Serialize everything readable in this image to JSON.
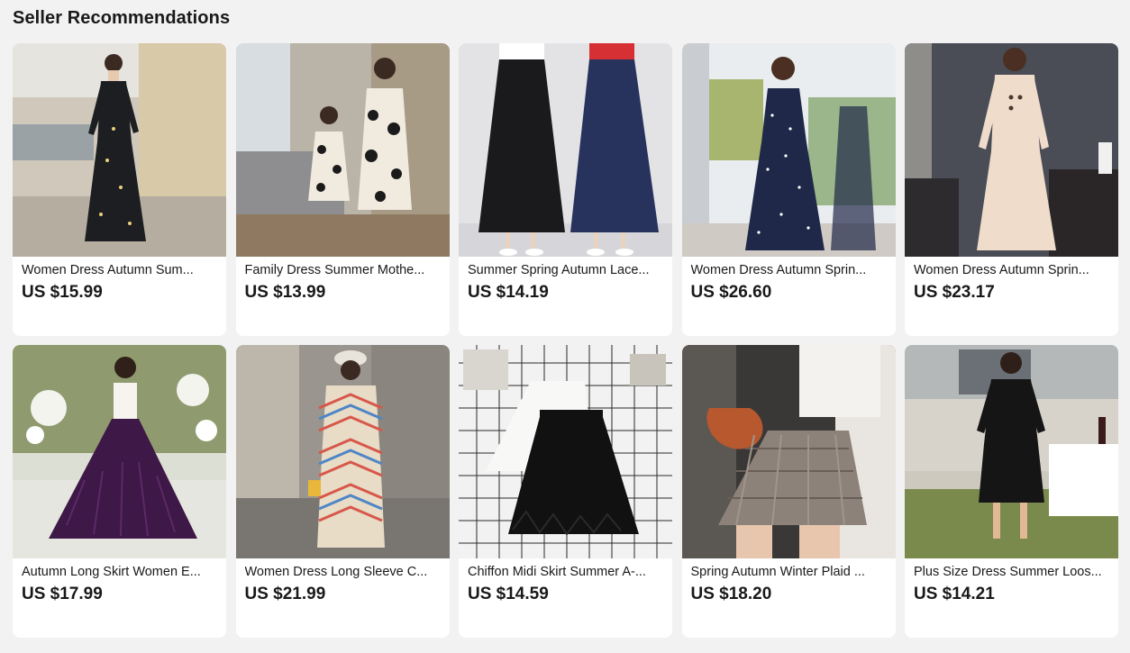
{
  "section": {
    "title": "Seller Recommendations"
  },
  "products": [
    {
      "title": "Women Dress Autumn Sum...",
      "price": "US $15.99",
      "image": "woman-black-floral-maxi-dress",
      "bg": "#d9d3c8",
      "garment": "#1c1c1e"
    },
    {
      "title": "Family Dress Summer Mothe...",
      "price": "US $13.99",
      "image": "mother-daughter-polka-dot-dresses",
      "bg": "#bdb9b1",
      "garment": "#f2ece0"
    },
    {
      "title": "Summer Spring Autumn Lace...",
      "price": "US $14.19",
      "image": "black-and-navy-lace-maxi-skirts",
      "bg": "#e4e4e6",
      "garment": "#1a1a1d"
    },
    {
      "title": "Women Dress Autumn Sprin...",
      "price": "US $26.60",
      "image": "woman-navy-polka-dot-dress",
      "bg": "#e8ecef",
      "garment": "#1e2747"
    },
    {
      "title": "Women Dress Autumn Sprin...",
      "price": "US $23.17",
      "image": "woman-cream-knit-dress",
      "bg": "#4a4c56",
      "garment": "#efdccb"
    },
    {
      "title": "Autumn Long Skirt Women E...",
      "price": "US $17.99",
      "image": "woman-purple-pleated-skirt",
      "bg": "#d8dccb",
      "garment": "#3d1846"
    },
    {
      "title": "Women Dress Long Sleeve C...",
      "price": "US $21.99",
      "image": "woman-chevron-knit-dress",
      "bg": "#9d9a95",
      "garment": "#e8dcc6"
    },
    {
      "title": "Chiffon Midi Skirt Summer A-...",
      "price": "US $14.59",
      "image": "black-and-white-feather-skirts",
      "bg": "#f1f1f1",
      "garment": "#111111"
    },
    {
      "title": "Spring Autumn Winter Plaid ...",
      "price": "US $18.20",
      "image": "plaid-pleated-mini-skirt",
      "bg": "#3c3a38",
      "garment": "#8b8078"
    },
    {
      "title": "Plus Size Dress Summer Loos...",
      "price": "US $14.21",
      "image": "woman-black-shirt-dress",
      "bg": "#c9c6bd",
      "garment": "#141414"
    }
  ]
}
